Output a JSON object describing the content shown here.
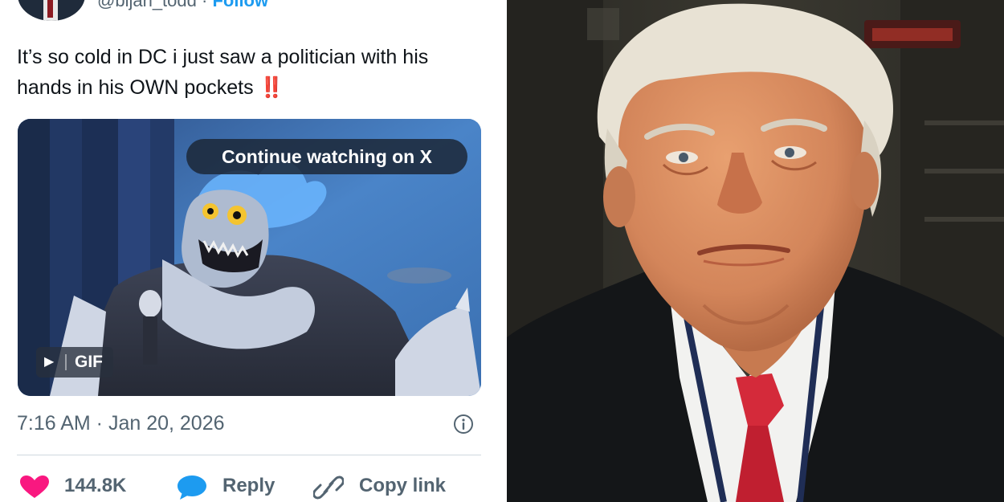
{
  "tweet": {
    "handle": "@bijan_todd",
    "separator": "·",
    "follow_label": "Follow",
    "text": "It’s so cold in DC i just saw a politician with his hands in his OWN pockets",
    "emoji": "‼️",
    "media": {
      "overlay_label": "Continue watching on X",
      "badge_label": "GIF",
      "play_glyph": "▶"
    },
    "timestamp": "7:16 AM · Jan 20, 2026",
    "actions": {
      "like_count": "144.8K",
      "reply_label": "Reply",
      "copy_label": "Copy link"
    },
    "icons": {
      "like": "heart-icon",
      "reply": "speech-bubble-icon",
      "copy": "link-icon",
      "info": "info-icon"
    },
    "colors": {
      "like": "#f91880",
      "reply": "#1d9bf0",
      "follow": "#1d9bf0",
      "text": "#0f1419",
      "muted": "#536471"
    }
  }
}
